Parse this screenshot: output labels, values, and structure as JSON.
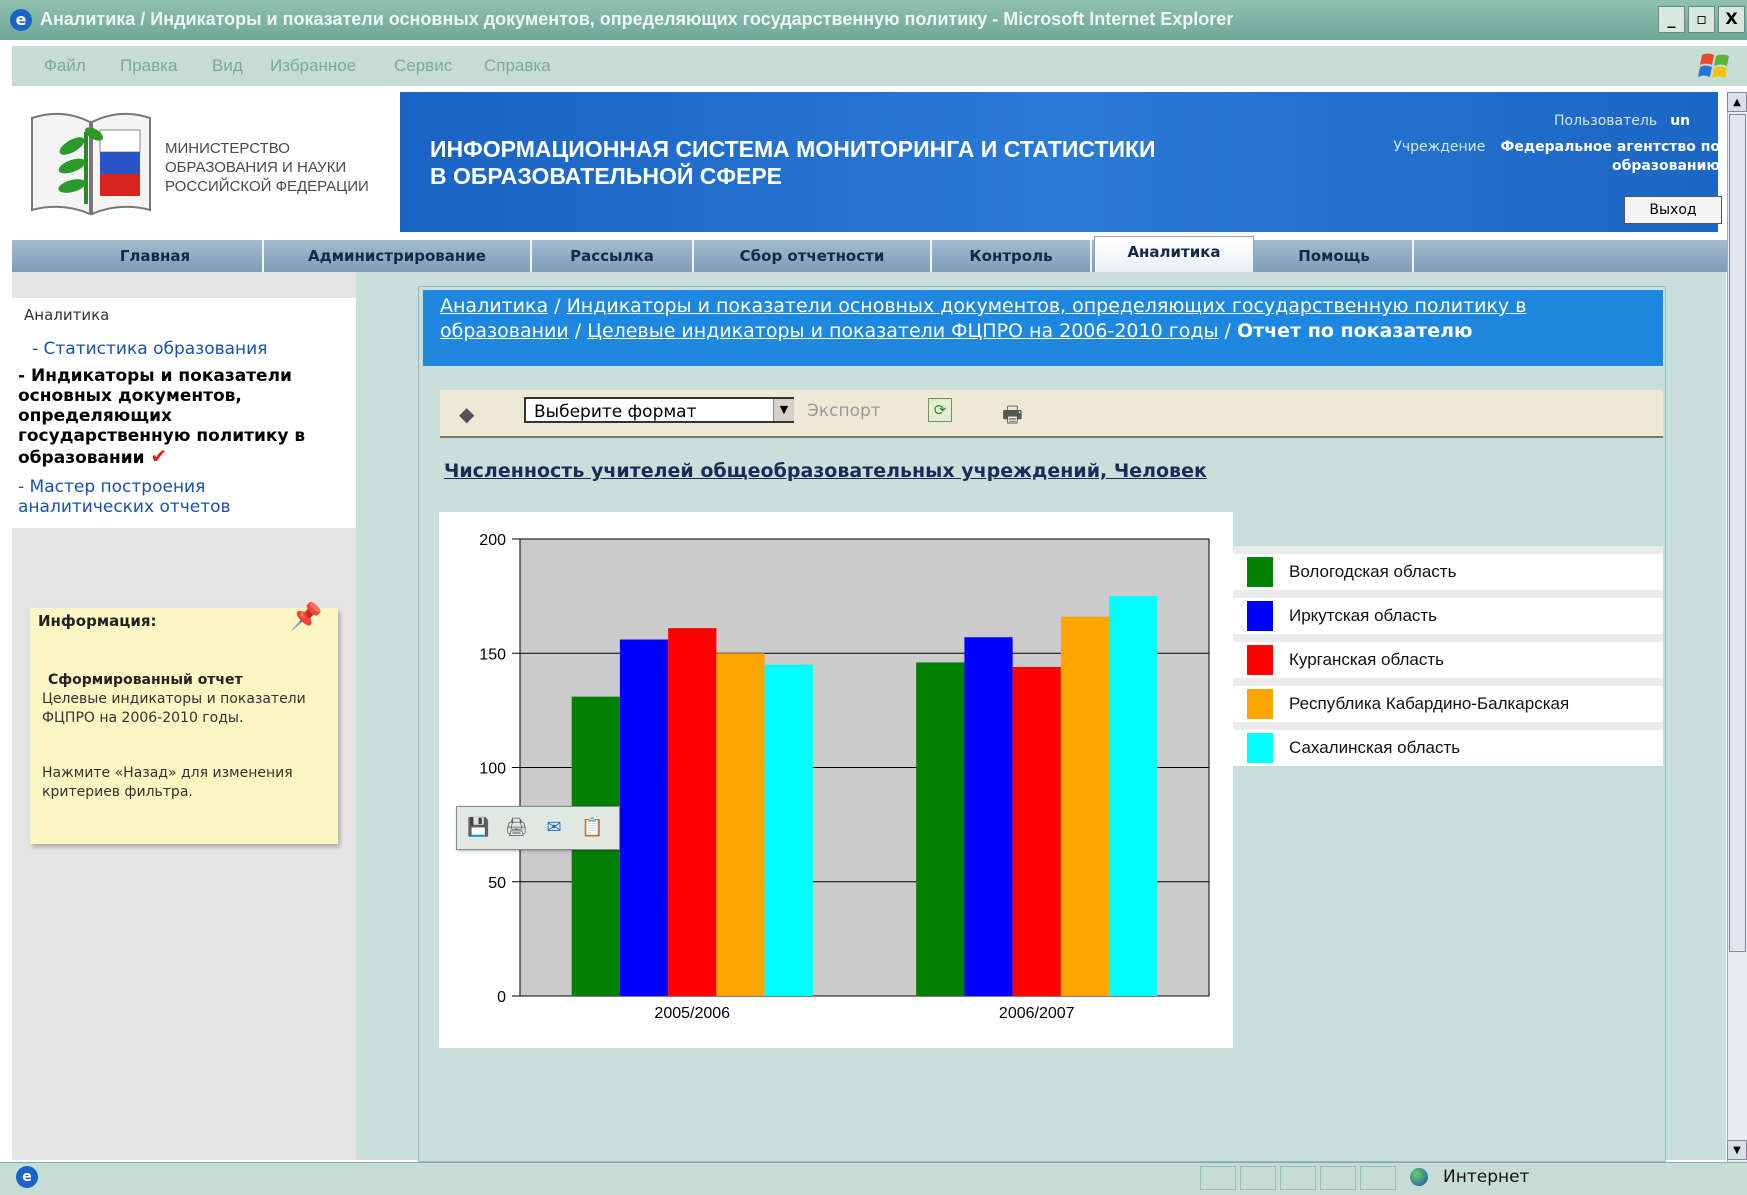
{
  "window": {
    "title": "Аналитика / Индикаторы и показатели основных документов, определяющих государственную политику  - Microsoft Internet Explorer",
    "controls": [
      "_",
      "▫",
      "X"
    ]
  },
  "menu": [
    "Файл",
    "Правка",
    "Вид",
    "Избранное",
    "Сервис",
    "Справка"
  ],
  "header": {
    "ministry_lines": [
      "МИНИСТЕРСТВО",
      "ОБРАЗОВАНИЯ И НАУКИ",
      "РОССИЙСКОЙ ФЕДЕРАЦИИ"
    ],
    "system_title_lines": [
      "ИНФОРМАЦИОННАЯ СИСТЕМА МОНИТОРИНГА И СТАТИСТИКИ",
      "В ОБРАЗОВАТЕЛЬНОЙ СФЕРЕ"
    ],
    "user_label": "Пользователь",
    "user_value": "un",
    "org_label": "Учреждение",
    "org_value_line1": "Федеральное агентство по",
    "org_value_line2": "образованию",
    "exit_label": "Выход"
  },
  "nav": {
    "tabs": [
      "Главная",
      "Администрирование",
      "Рассылка",
      "Сбор отчетности",
      "Контроль",
      "Аналитика",
      "Помощь"
    ],
    "active": "Аналитика"
  },
  "sidebar": {
    "title": "Аналитика",
    "items": [
      {
        "label": "- Статистика образования"
      },
      {
        "label": "- Индикаторы и показатели основных документов, определяющих государственную политику в образовании"
      },
      {
        "label": "- Мастер построения аналитических отчетов"
      }
    ],
    "info": {
      "title": "Информация:",
      "report_title": "Сформированный отчет",
      "report_desc": "Целевые индикаторы и показатели ФЦПРО на 2006-2010 годы.",
      "back_hint": "Нажмите «Назад» для изменения критериев фильтра."
    }
  },
  "breadcrumb": {
    "links": [
      "Аналитика",
      "Индикаторы и показатели основных документов, определяющих государственную политику в образовании",
      "Целевые индикаторы и показатели ФЦПРО на 2006-2010 годы"
    ],
    "separator": " / ",
    "current": "Отчет по показателю"
  },
  "toolbar": {
    "format_placeholder": "Выберите формат",
    "export_label": "Экспорт"
  },
  "report": {
    "title": "Численность учителей общеобразовательных учреждений, Человек"
  },
  "chart_data": {
    "type": "bar",
    "categories": [
      "2005/2006",
      "2006/2007"
    ],
    "series": [
      {
        "name": "Вологодская область",
        "color": "#008000",
        "values": [
          131,
          146
        ]
      },
      {
        "name": "Иркутская область",
        "color": "#0000ff",
        "values": [
          156,
          157
        ]
      },
      {
        "name": "Курганская область",
        "color": "#ff0000",
        "values": [
          161,
          144
        ]
      },
      {
        "name": "Республика Кабардино-Балкарская",
        "color": "#ffa500",
        "values": [
          150,
          166
        ]
      },
      {
        "name": "Сахалинская область",
        "color": "#00ffff",
        "values": [
          145,
          175
        ]
      }
    ],
    "ylim": [
      0,
      200
    ],
    "yticks": [
      0,
      50,
      100,
      150,
      200
    ],
    "grid": true,
    "legend": "right"
  },
  "statusbar": {
    "zone": "Интернет"
  }
}
